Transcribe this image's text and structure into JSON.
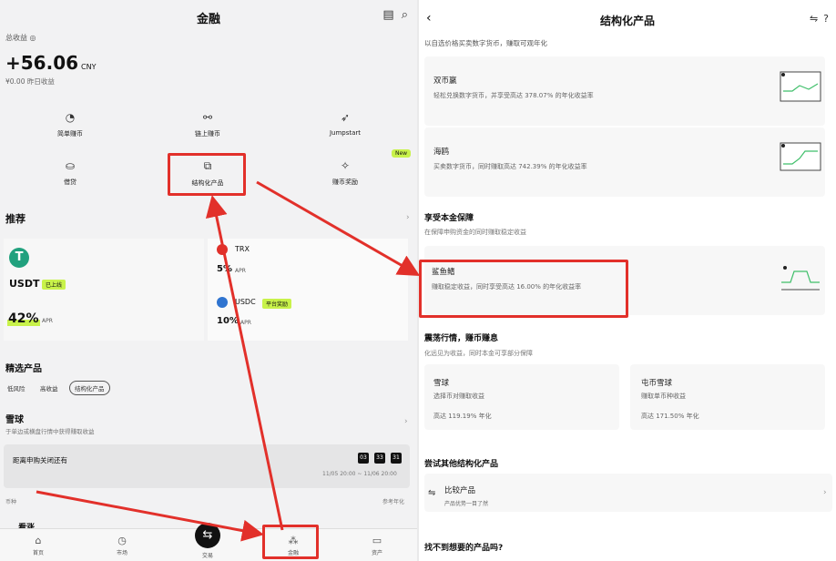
{
  "left": {
    "title": "金融",
    "total_label": "总收益 ◎",
    "total_value": "+56.06",
    "total_unit": "CNY",
    "yesterday": "¥0.00 昨日收益",
    "grid": [
      {
        "label": "简单赚币",
        "icon": "piggy-icon"
      },
      {
        "label": "链上赚币",
        "icon": "chain-icon"
      },
      {
        "label": "Jumpstart",
        "icon": "rocket-icon"
      },
      {
        "label": "借贷",
        "icon": "loan-icon"
      },
      {
        "label": "结构化产品",
        "icon": "structured-icon"
      },
      {
        "label": "赚币奖励",
        "icon": "reward-icon"
      }
    ],
    "new_badge": "New",
    "recommend_title": "推荐",
    "usdt": {
      "name": "USDT",
      "tag": "已上线",
      "pct": "42%",
      "apr": "APR",
      "logo": "T"
    },
    "trx": {
      "name": "TRX",
      "pct": "5%",
      "apr": "APR"
    },
    "usdc": {
      "name": "USDC",
      "tag": "平台奖励",
      "pct": "10%",
      "apr": "APR"
    },
    "featured_title": "精选产品",
    "filters": [
      "低风险",
      "高收益",
      "结构化产品"
    ],
    "snowball_title": "雪球",
    "snowball_sub": "于单边或横盘行情中获得赚取收益",
    "countdown_label": "距离申购关闭还有",
    "countdown_boxes": [
      "03",
      "33",
      "31"
    ],
    "countdown_range": "11/05 20:00 ~ 11/06 20:00",
    "coin_label": "币种",
    "ref_label": "参考年化",
    "kanzhang": "看涨",
    "nav": [
      {
        "label": "首页",
        "icon": "home-icon"
      },
      {
        "label": "市场",
        "icon": "market-icon"
      },
      {
        "label": "交易",
        "icon": "trade-icon"
      },
      {
        "label": "金融",
        "icon": "finance-icon"
      },
      {
        "label": "资产",
        "icon": "wallet-icon"
      }
    ]
  },
  "right": {
    "title": "结构化产品",
    "top_sub": "以自选价格买卖数字货币，赚取可观年化",
    "dual": {
      "title": "双币赢",
      "desc": "轻松兑换数字货币，并享受高达 378.07% 的年化收益率"
    },
    "shark": {
      "title": "海鸥",
      "desc": "买卖数字货币，同时赚取高达 742.39% 的年化收益率"
    },
    "protected_title": "享受本金保障",
    "protected_sub": "在保障申购资金的同时赚取稳定收益",
    "sharkfin": {
      "title": "鲨鱼鳍",
      "desc": "赚取稳定收益，同时享受高达 16.00% 的年化收益率"
    },
    "volatile_title": "震荡行情，赚币赚息",
    "volatile_sub": "化远见为收益，同时本金可享部分保障",
    "snow": {
      "title": "雪球",
      "desc": "选择币对赚取收益",
      "rate": "高达 119.19% 年化"
    },
    "coin_snow": {
      "title": "屯币雪球",
      "desc": "赚取单币种收益",
      "rate": "高达 171.50% 年化"
    },
    "other_title": "尝试其他结构化产品",
    "compare": {
      "title": "比较产品",
      "desc": "产品优势一目了然"
    },
    "not_found": "找不到想要的产品吗?"
  },
  "colors": {
    "accent_green": "#c8f24a",
    "highlight_red": "#e2302a",
    "tether_green": "#21a17e"
  }
}
